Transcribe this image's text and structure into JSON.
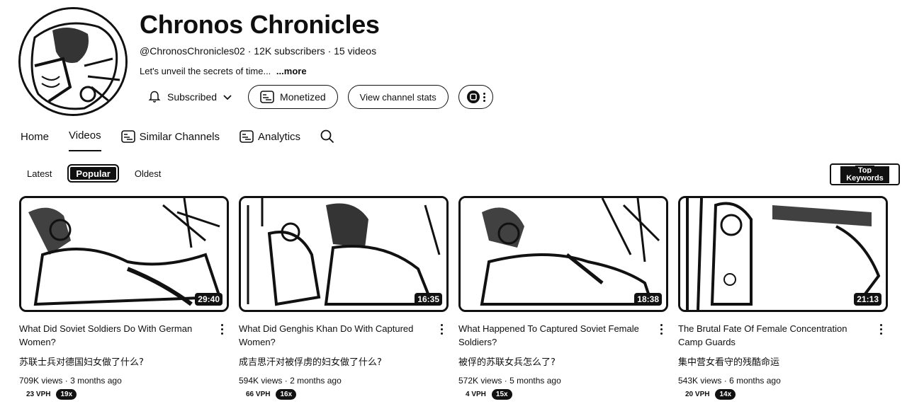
{
  "channel": {
    "name": "Chronos Chronicles",
    "handle": "@ChronosChronicles02",
    "subscribers": "12K subscribers",
    "videos_count": "15 videos",
    "separator": "·",
    "description": "Let's unveil the secrets of time...",
    "more": "...more"
  },
  "actions": {
    "subscribed_label": "Subscribed",
    "monetized_label": "Monetized",
    "stats_label": "View channel stats"
  },
  "tabs": [
    {
      "label": "Home"
    },
    {
      "label": "Videos",
      "active": true
    },
    {
      "label": "Similar Channels"
    },
    {
      "label": "Analytics"
    }
  ],
  "filters": [
    {
      "label": "Latest"
    },
    {
      "label": "Popular",
      "active": true
    },
    {
      "label": "Oldest"
    }
  ],
  "top_keywords": {
    "line1": "Top",
    "line2": "Keywords"
  },
  "videos": [
    {
      "title": "What Did Soviet Soldiers Do With German Women?",
      "title_cn": "苏联士兵对德国妇女做了什么?",
      "duration": "29:40",
      "views": "709K views",
      "age": "3 months ago",
      "vph": "23 VPH",
      "multiplier": "19x"
    },
    {
      "title": "What Did Genghis Khan Do With Captured Women?",
      "title_cn": "成吉思汗对被俘虏的妇女做了什么?",
      "duration": "16:35",
      "views": "594K views",
      "age": "2 months ago",
      "vph": "66 VPH",
      "multiplier": "16x"
    },
    {
      "title": "What Happened To Captured Soviet Female Soldiers?",
      "title_cn": "被俘的苏联女兵怎么了?",
      "duration": "18:38",
      "views": "572K views",
      "age": "5 months ago",
      "vph": "4 VPH",
      "multiplier": "15x"
    },
    {
      "title": "The Brutal Fate Of Female Concentration Camp Guards",
      "title_cn": "集中营女看守的残酷命运",
      "duration": "21:13",
      "views": "543K views",
      "age": "6 months ago",
      "vph": "20 VPH",
      "multiplier": "14x"
    }
  ]
}
